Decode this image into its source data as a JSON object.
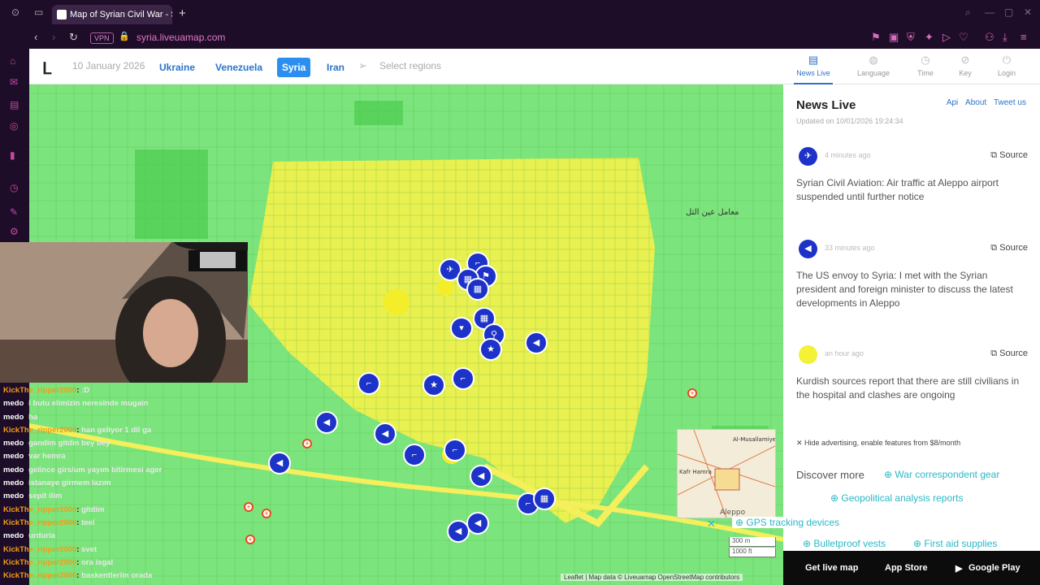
{
  "browser": {
    "tab_title": "Map of Syrian Civil War - S",
    "url": "syria.liveuamap.com",
    "vpn": "VPN"
  },
  "header": {
    "date": "10 January 2026",
    "tabs": [
      {
        "label": "Ukraine",
        "active": false
      },
      {
        "label": "Venezuela",
        "active": false
      },
      {
        "label": "Syria",
        "active": true
      },
      {
        "label": "Iran",
        "active": false
      }
    ],
    "select_regions": "Select regions",
    "icons": [
      {
        "label": "News Live",
        "icon": "news-icon",
        "active": true
      },
      {
        "label": "Language",
        "icon": "globe-icon",
        "active": false
      },
      {
        "label": "Time",
        "icon": "clock-icon",
        "active": false
      },
      {
        "label": "Key",
        "icon": "key-icon",
        "active": false
      },
      {
        "label": "Login",
        "icon": "login-icon",
        "active": false
      }
    ]
  },
  "panel": {
    "title": "News Live",
    "links": [
      "Api",
      "About",
      "Tweet us"
    ],
    "updated": "Updated on 10/01/2026 19:24:34",
    "items": [
      {
        "ago": "4 minutes ago",
        "source": "Source",
        "text": "Syrian Civil Aviation: Air traffic at Aleppo airport suspended until further notice",
        "icon": "airplane-icon",
        "color": "#1d32c8"
      },
      {
        "ago": "33 minutes ago",
        "source": "Source",
        "text": "The US envoy to Syria: I met with the Syrian president and foreign minister to discuss the latest developments in Aleppo",
        "icon": "megaphone-icon",
        "color": "#1d32c8"
      },
      {
        "ago": "an hour ago",
        "source": "Source",
        "text": "Kurdish sources report that there are still civilians in the hospital and clashes are ongoing",
        "icon": "yellow-circle-icon",
        "color": "#f4f236"
      }
    ],
    "hide_ad": "Hide advertising, enable features from $8/month",
    "discover": "Discover more",
    "ads": [
      "War correspondent gear",
      "Geopolitical analysis reports",
      "GPS tracking devices",
      "Bulletproof vests",
      "First aid supplies"
    ]
  },
  "bottom": {
    "get_live_map": "Get live map",
    "app_store": "App Store",
    "google_play": "Google Play"
  },
  "map": {
    "city_label": "Aleppo",
    "minimap_labels": [
      "Al-Musallamiye",
      "Kafr Hamra",
      "Aleppo"
    ],
    "scale": [
      "300 m",
      "1000 ft"
    ],
    "attribution": "Leaflet | Map data © Liveuamap OpenStreetMap contributors",
    "arabic_label": "معامل عين التل"
  },
  "chat": [
    {
      "user": "KickThe_ripper2000",
      "msg": ":D"
    },
    {
      "user": "medo",
      "msg": "i butu elimizin neresinde mugain"
    },
    {
      "user": "medo",
      "msg": "ha"
    },
    {
      "user": "KickThe_ripper2000",
      "msg": "han geliyor 1 dil ga"
    },
    {
      "user": "medo",
      "msg": "gandim gitdin bey bey"
    },
    {
      "user": "medo",
      "msg": "var hemra"
    },
    {
      "user": "medo",
      "msg": "gelince girs/um yayım bitirmesi ager"
    },
    {
      "user": "medo",
      "msg": "istanaye girmem lazım"
    },
    {
      "user": "medo",
      "msg": "sepit ilim"
    },
    {
      "user": "KickThe_ripper2000",
      "msg": "gitdim"
    },
    {
      "user": "KickThe_ripper2000",
      "msg": "teel"
    },
    {
      "user": "medo",
      "msg": "urduria"
    },
    {
      "user": "KickThe_ripper2000",
      "msg": "svet"
    },
    {
      "user": "KickThe_ripper2000",
      "msg": "ora isgal"
    },
    {
      "user": "KickThe_ripper2000",
      "msg": "baskentleriin orada"
    }
  ]
}
